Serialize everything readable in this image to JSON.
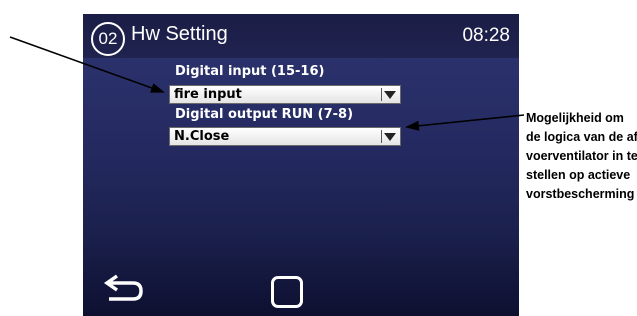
{
  "header": {
    "page_number": "02",
    "title": "Hw Setting",
    "time": "08:28"
  },
  "fields": [
    {
      "label": "Digital input (15-16)",
      "value": "fire input"
    },
    {
      "label": "Digital output RUN (7-8)",
      "value": "N.Close"
    }
  ],
  "nav": {
    "back_icon": "back-arrow-icon",
    "home_icon": "home-square-icon"
  },
  "annotation": {
    "lines": [
      "Mogelijkheid om",
      "de logica van de af-",
      "voerventilator in te",
      "stellen op actieve",
      "vorstbescherming"
    ]
  },
  "colors": {
    "screen_top": "#2e3470",
    "screen_bottom": "#0d1030",
    "header_bg": "#1a1d45",
    "text": "#ffffff"
  }
}
